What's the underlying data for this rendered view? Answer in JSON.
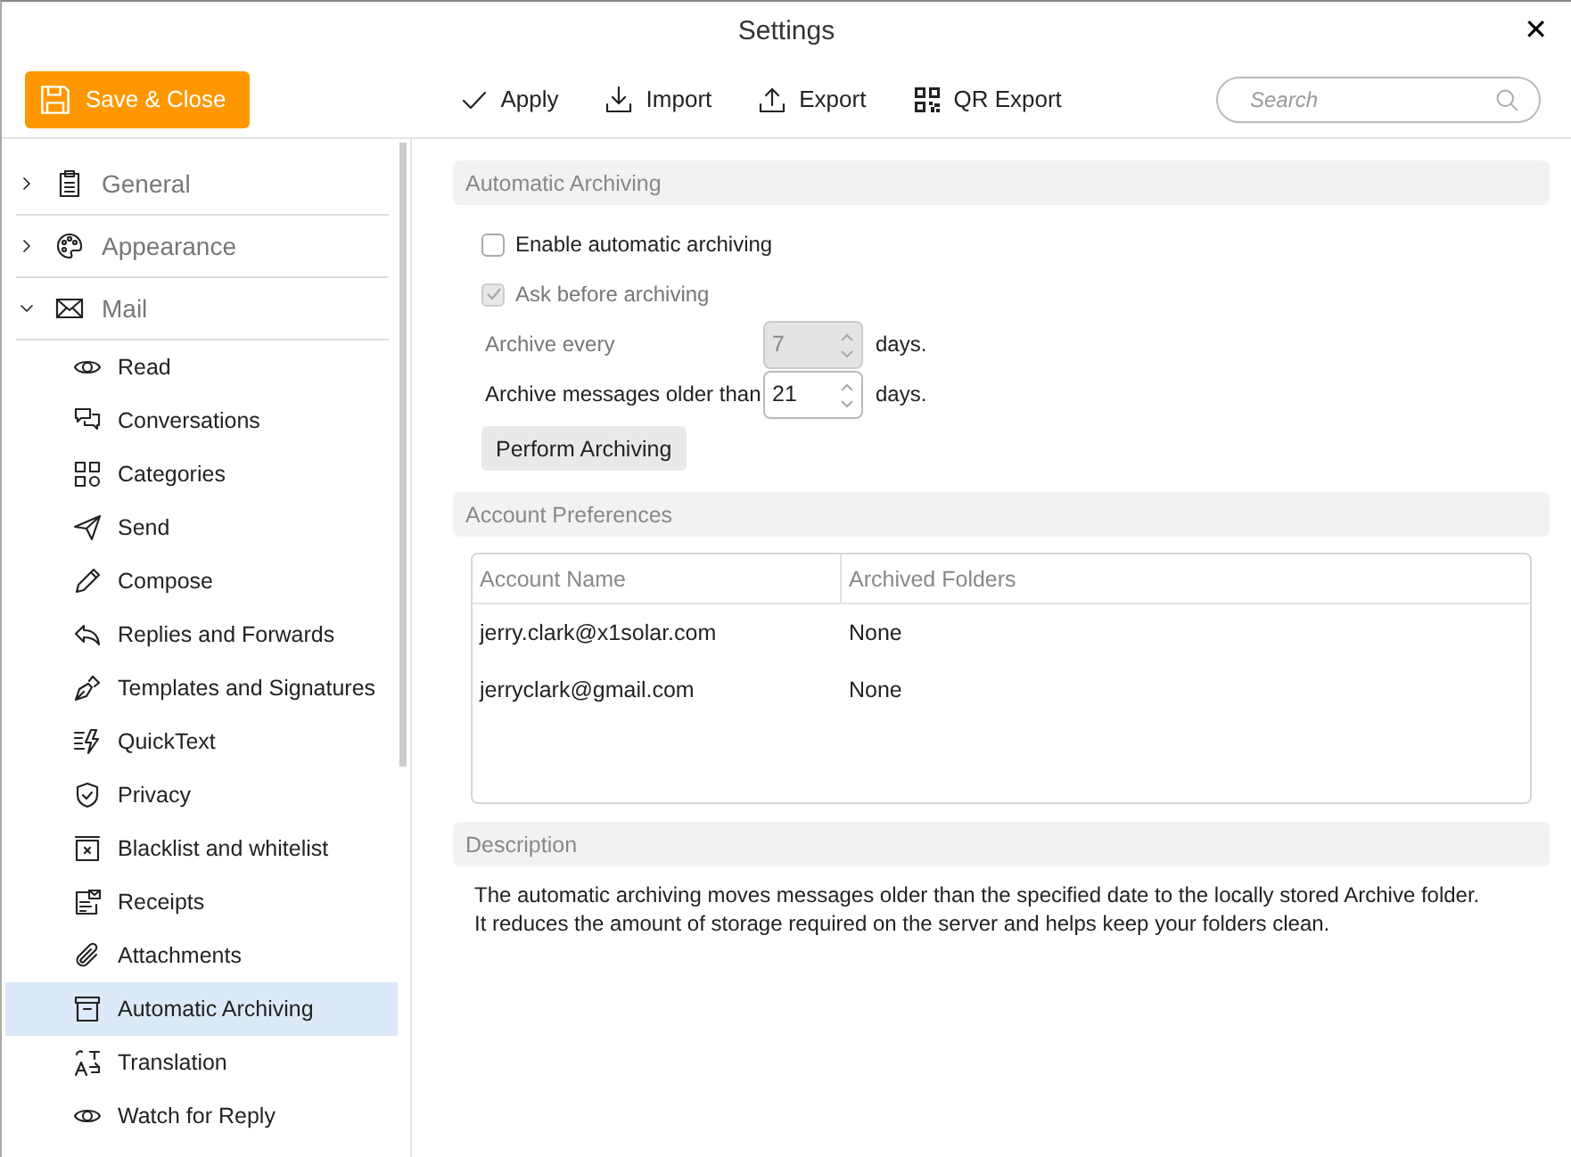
{
  "window": {
    "title": "Settings",
    "close_button": "✕"
  },
  "toolbar": {
    "save_button": "Save & Close",
    "actions": [
      {
        "label": "Apply",
        "kind": "check"
      },
      {
        "label": "Import",
        "kind": "import"
      },
      {
        "label": "Export",
        "kind": "export"
      },
      {
        "label": "QR Export",
        "kind": "qr"
      }
    ],
    "search": {
      "placeholder": "Search"
    }
  },
  "sidebar": {
    "items": [
      {
        "label": "General",
        "kind": "clipboard",
        "expanded": false
      },
      {
        "label": "Appearance",
        "kind": "palette",
        "expanded": false
      },
      {
        "label": "Mail",
        "kind": "mail",
        "expanded": true,
        "children": [
          {
            "label": "Read",
            "kind": "eye",
            "selected": false
          },
          {
            "label": "Conversations",
            "kind": "chat",
            "selected": false
          },
          {
            "label": "Categories",
            "kind": "grid",
            "selected": false
          },
          {
            "label": "Send",
            "kind": "send",
            "selected": false
          },
          {
            "label": "Compose",
            "kind": "pencil",
            "selected": false
          },
          {
            "label": "Replies and Forwards",
            "kind": "reply",
            "selected": false
          },
          {
            "label": "Templates and Signatures",
            "kind": "pen",
            "selected": false
          },
          {
            "label": "QuickText",
            "kind": "bolt",
            "selected": false
          },
          {
            "label": "Privacy",
            "kind": "shield",
            "selected": false
          },
          {
            "label": "Blacklist and whitelist",
            "kind": "block",
            "selected": false
          },
          {
            "label": "Receipts",
            "kind": "receipt",
            "selected": false
          },
          {
            "label": "Attachments",
            "kind": "clip",
            "selected": false
          },
          {
            "label": "Automatic Archiving",
            "kind": "archive",
            "selected": true
          },
          {
            "label": "Translation",
            "kind": "translate",
            "selected": false
          },
          {
            "label": "Watch for Reply",
            "kind": "eye",
            "selected": false
          }
        ]
      }
    ]
  },
  "automatic_archiving": {
    "title": "Automatic Archiving",
    "options": [
      {
        "label": "Enable automatic archiving",
        "checked": false,
        "disabled": false
      },
      {
        "label": "Ask before archiving",
        "checked": true,
        "disabled": true
      }
    ],
    "fields": [
      {
        "label": "Archive every",
        "value": "7",
        "unit": "days.",
        "disabled": true
      },
      {
        "label": "Archive messages older than",
        "value": "21",
        "unit": "days.",
        "disabled": false
      }
    ],
    "button": "Perform Archiving"
  },
  "account_preferences": {
    "title": "Account Preferences",
    "table": {
      "columns": [
        "Account Name",
        "Archived Folders"
      ],
      "rows": [
        [
          "jerry.clark@x1solar.com",
          "None"
        ],
        [
          "jerryclark@gmail.com",
          "None"
        ]
      ]
    }
  },
  "description": {
    "title": "Description",
    "lines": [
      "The automatic archiving moves messages older than the specified date to the locally stored Archive folder.",
      "It reduces the amount of storage required on the server and helps keep your folders clean."
    ]
  }
}
